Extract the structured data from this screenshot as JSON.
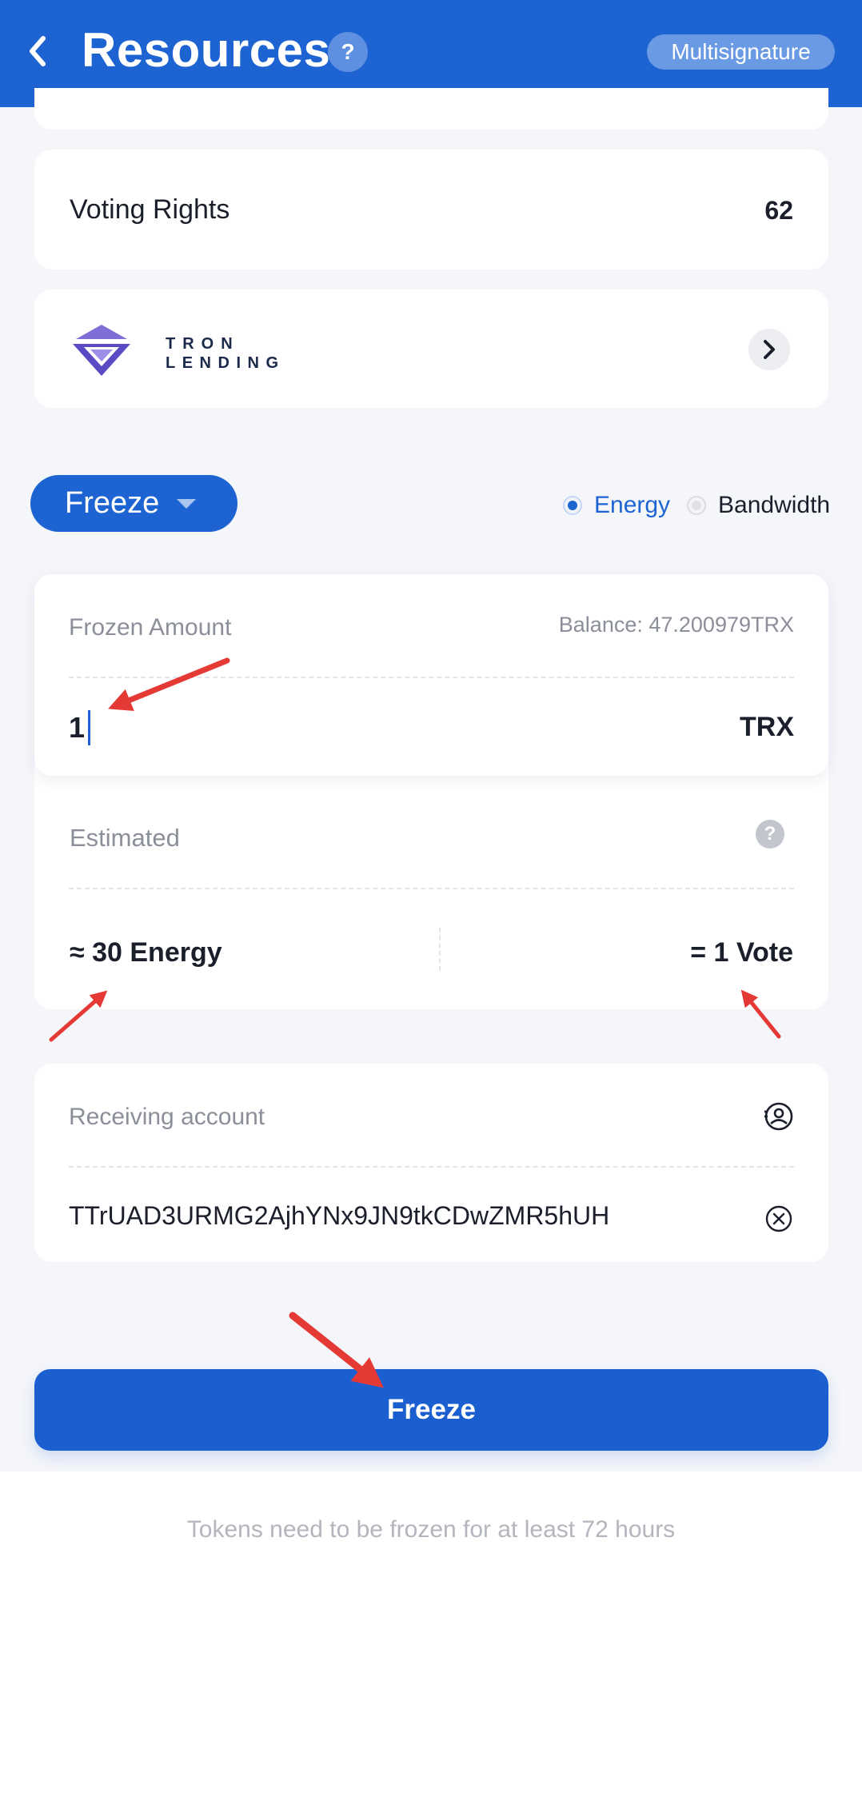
{
  "header": {
    "title": "Resources",
    "help_label": "?",
    "multisig_label": "Multisignature"
  },
  "voting": {
    "label": "Voting Rights",
    "value": "62"
  },
  "lending": {
    "logo_line1": "TRON",
    "logo_line2": "LENDING"
  },
  "action": {
    "dropdown_label": "Freeze",
    "radio_options": [
      {
        "label": "Energy",
        "selected": true
      },
      {
        "label": "Bandwidth",
        "selected": false
      }
    ]
  },
  "amount": {
    "label": "Frozen Amount",
    "balance": "Balance: 47.200979TRX",
    "value": "1",
    "unit": "TRX"
  },
  "estimated": {
    "label": "Estimated",
    "help_label": "?",
    "energy": "≈ 30 Energy",
    "vote": "= 1 Vote"
  },
  "receiving": {
    "label": "Receiving account",
    "address": "TTrUAD3URMG2AjhYNx9JN9tkCDwZMR5hUH"
  },
  "submit": {
    "label": "Freeze"
  },
  "note": "Tokens need to be frozen for at least 72 hours",
  "colors": {
    "primary": "#1d64d2",
    "annotation_arrow": "#e53935"
  },
  "icons": {
    "back": "chevron-left-icon",
    "lending_chevron": "chevron-right-icon",
    "contact": "contact-book-icon",
    "clear": "clear-circle-icon"
  }
}
